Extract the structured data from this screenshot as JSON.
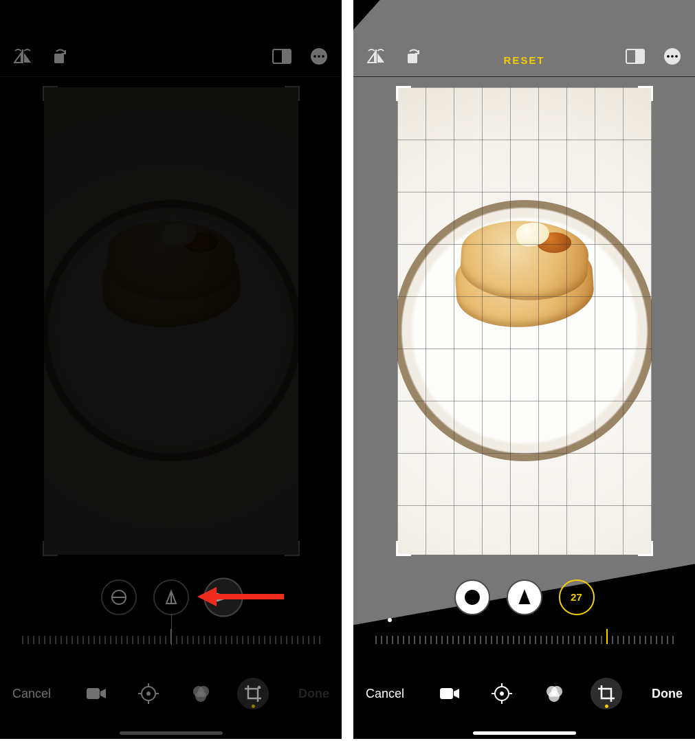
{
  "left": {
    "reset_label": "",
    "adjust_value": "",
    "cancel_label": "Cancel",
    "done_label": "Done"
  },
  "right": {
    "reset_label": "RESET",
    "adjust_value": "27",
    "cancel_label": "Cancel",
    "done_label": "Done"
  },
  "icons": {
    "flip": "flip-horizontal-icon",
    "rotate": "rotate-icon",
    "aspect": "aspect-ratio-icon",
    "more": "more-icon",
    "straighten": "straighten-icon",
    "vertical": "perspective-vertical-icon",
    "horizontal": "perspective-horizontal-icon",
    "video": "video-icon",
    "adjust": "adjust-icon",
    "filters": "filters-icon",
    "crop": "crop-icon"
  }
}
